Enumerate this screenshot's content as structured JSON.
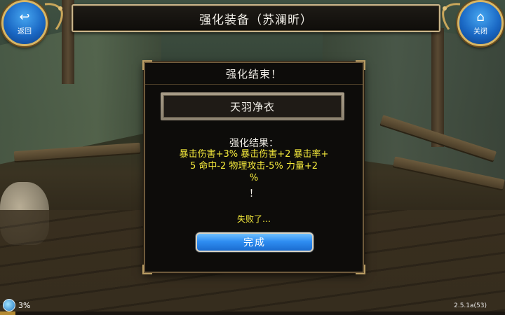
{
  "header": {
    "title": "强化装备（苏澜昕）",
    "back_label": "返回",
    "close_label": "关闭",
    "back_icon": "back-arrow-icon",
    "close_icon": "home-icon"
  },
  "dialog": {
    "title": "强化结束！",
    "item_name": "天羽净衣",
    "result_label": "强化结果：",
    "result_lines": [
      "暴击伤害+3% 暴击伤害+2 暴击率+",
      "5 命中-2 物理攻击-5% 力量+2",
      "%"
    ],
    "result_end": "！",
    "fail_text": "失败了…",
    "done_button": "完成"
  },
  "status": {
    "percent_text": "3%",
    "progress": 0.03,
    "version": "2.5.1a(53)"
  },
  "colors": {
    "accent_blue": "#2f8ef2",
    "result_yellow": "#f5ea3c",
    "frame_gold": "#c9b48a"
  }
}
